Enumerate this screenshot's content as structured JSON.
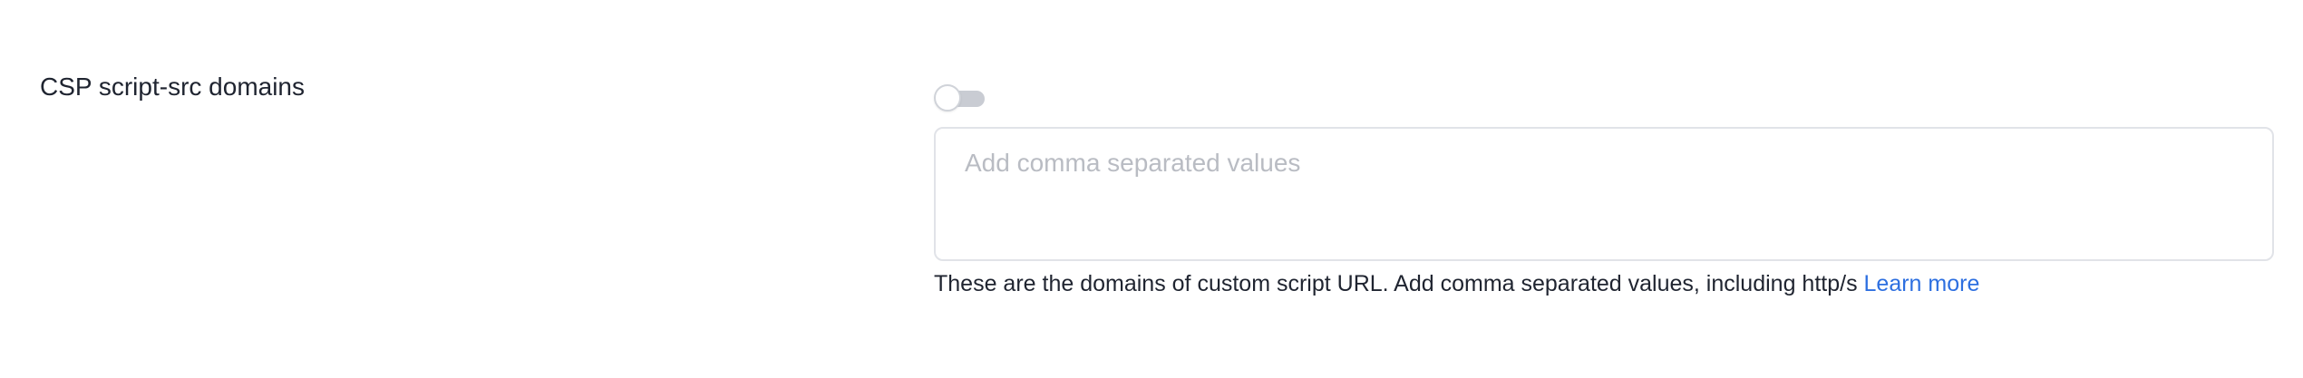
{
  "setting": {
    "label": "CSP script-src domains",
    "toggle_on": false,
    "input": {
      "value": "",
      "placeholder": "Add comma separated values"
    },
    "help_text": "These are the domains of custom script URL. Add comma separated values, including http/s",
    "help_link_label": "Learn more"
  },
  "colors": {
    "text": "#1f2430",
    "link": "#2d6fe0",
    "placeholder": "#b9bcc3",
    "toggle_track": "#c9ccd3",
    "input_border": "#e1e3e8"
  }
}
